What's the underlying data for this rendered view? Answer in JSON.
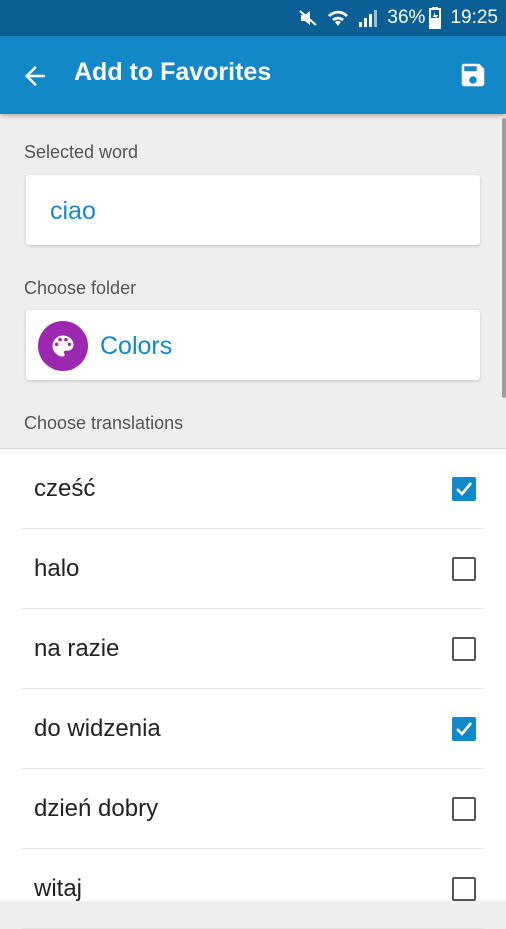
{
  "status_bar": {
    "battery_percent": "36%",
    "time": "19:25",
    "icons": [
      "mute-icon",
      "wifi-icon",
      "signal-icon",
      "battery-icon"
    ]
  },
  "app_bar": {
    "title": "Add to Favorites",
    "back_icon": "arrow-back-icon",
    "save_icon": "save-icon"
  },
  "selected_word": {
    "label": "Selected word",
    "value": "ciao"
  },
  "folder": {
    "label": "Choose folder",
    "value": "Colors",
    "icon": "palette-icon",
    "icon_color": "#9c27b0"
  },
  "translations": {
    "label": "Choose translations",
    "items": [
      {
        "label": "cześć",
        "checked": true
      },
      {
        "label": "halo",
        "checked": false
      },
      {
        "label": "na razie",
        "checked": false
      },
      {
        "label": "do widzenia",
        "checked": true
      },
      {
        "label": "dzień dobry",
        "checked": false
      },
      {
        "label": "witaj",
        "checked": false
      }
    ]
  },
  "colors": {
    "primary": "#1288c8",
    "status_bar": "#0b5f94",
    "background": "#eeeeee"
  }
}
